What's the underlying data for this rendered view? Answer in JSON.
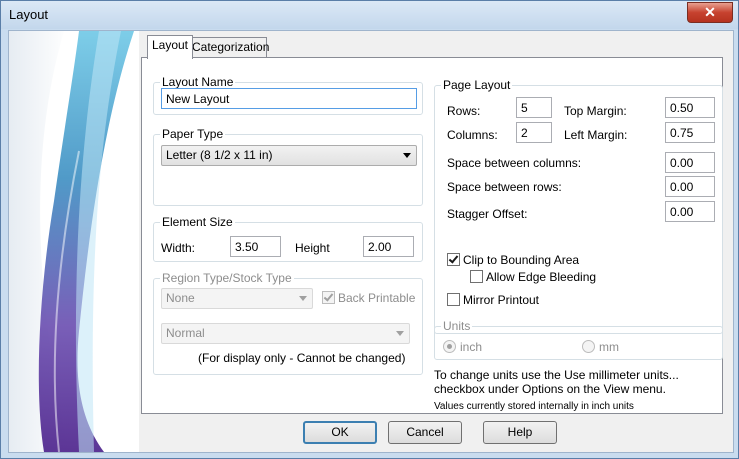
{
  "window": {
    "title": "Layout",
    "close_symbol": "✕"
  },
  "tabs": [
    {
      "label": "Layout",
      "active": true
    },
    {
      "label": "Categorization",
      "active": false
    }
  ],
  "layout_name": {
    "label": "Layout Name",
    "value": "New Layout"
  },
  "paper_type": {
    "label": "Paper Type",
    "value": "Letter (8 1/2 x 11 in)"
  },
  "element_size": {
    "label": "Element Size",
    "width_label": "Width:",
    "width_value": "3.50",
    "height_label": "Height",
    "height_value": "2.00"
  },
  "region": {
    "label": "Region Type/Stock Type",
    "region_value": "None",
    "back_printable_label": "Back Printable",
    "back_printable_checked": true,
    "stock_value": "Normal",
    "note": "(For display only - Cannot be changed)"
  },
  "page_layout": {
    "label": "Page Layout",
    "rows_label": "Rows:",
    "rows_value": "5",
    "columns_label": "Columns:",
    "columns_value": "2",
    "top_margin_label": "Top Margin:",
    "top_margin_value": "0.50",
    "left_margin_label": "Left Margin:",
    "left_margin_value": "0.75",
    "space_columns_label": "Space between columns:",
    "space_columns_value": "0.00",
    "space_rows_label": "Space between rows:",
    "space_rows_value": "0.00",
    "stagger_label": "Stagger Offset:",
    "stagger_value": "0.00",
    "clip_label": "Clip to Bounding Area",
    "clip_checked": true,
    "bleed_label": "Allow Edge Bleeding",
    "bleed_checked": false,
    "mirror_label": "Mirror Printout",
    "mirror_checked": false
  },
  "units": {
    "label": "Units",
    "inch_label": "inch",
    "inch_selected": true,
    "mm_label": "mm",
    "mm_selected": false,
    "info": "To change units use the Use millimeter units... checkbox under Options on the View menu.",
    "stored_note": "Values currently stored internally in inch units"
  },
  "buttons": {
    "ok": "OK",
    "cancel": "Cancel",
    "help": "Help"
  },
  "colors": {
    "accent": "#569de5",
    "title_bar": "#c9dcef",
    "close_button": "#c7422f"
  }
}
